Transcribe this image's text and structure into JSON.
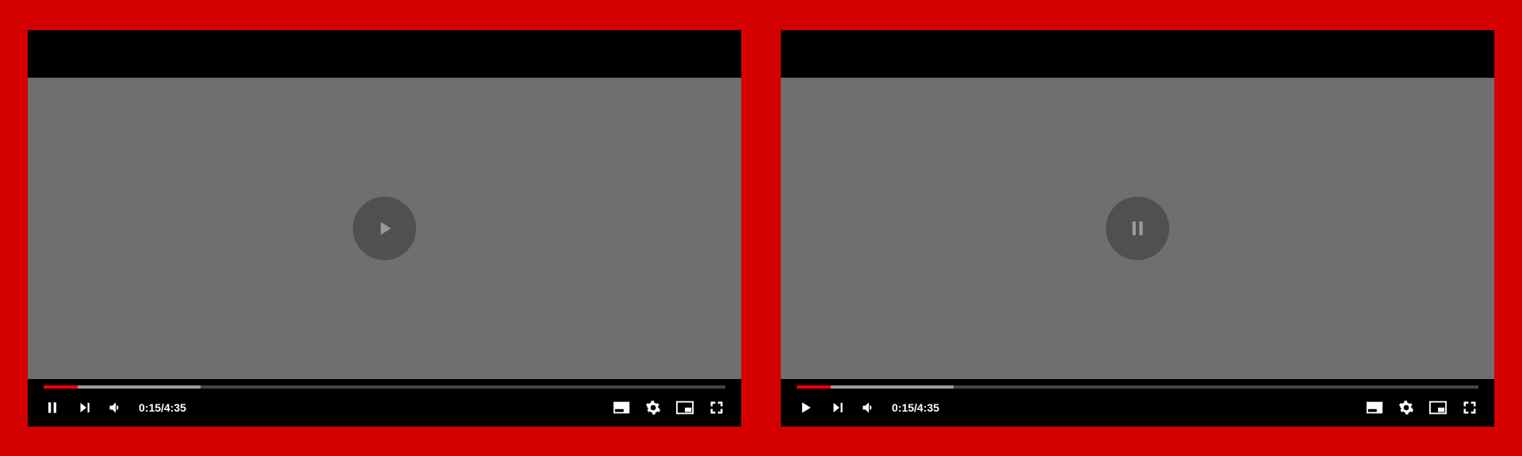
{
  "players": [
    {
      "state": "paused",
      "center_icon": "play",
      "left_icon": "pause",
      "elapsed": "0:15",
      "duration": "4:35",
      "played_percent": 5,
      "buffered_percent": 18
    },
    {
      "state": "playing",
      "center_icon": "pause",
      "left_icon": "play",
      "elapsed": "0:15",
      "duration": "4:35",
      "played_percent": 5,
      "buffered_percent": 18
    }
  ],
  "colors": {
    "background": "#d40000",
    "progress_played": "#ff0000",
    "video_area": "#6f6f6f"
  },
  "separator": "/"
}
